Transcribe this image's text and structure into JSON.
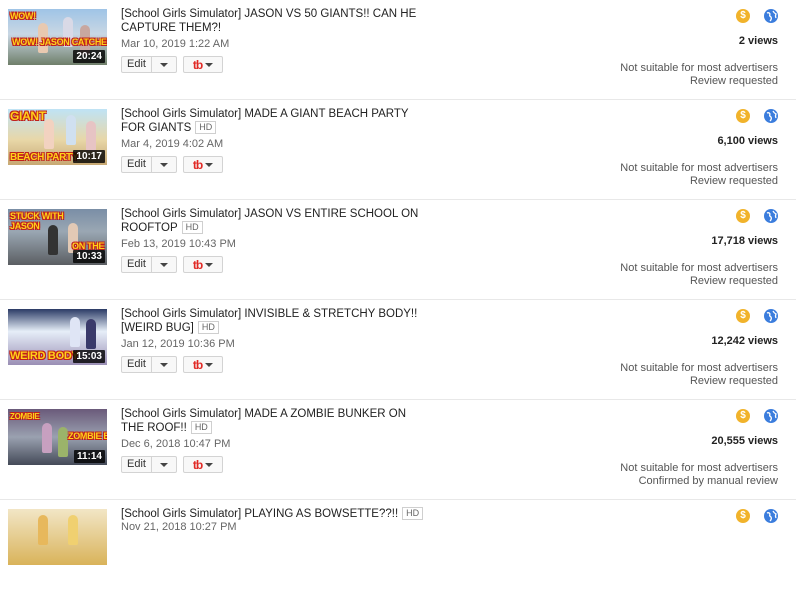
{
  "videos": [
    {
      "title": "[School Girls Simulator] JASON VS 50 GIANTS!! CAN HE CAPTURE THEM?!",
      "hd": "",
      "date": "Mar 10, 2019 1:22 AM",
      "duration": "20:24",
      "thumb_caption": "WOW! JASON CATCHES GIANTS",
      "views": "2 views",
      "ad_status": "Not suitable for most advertisers",
      "review_status": "Review requested"
    },
    {
      "title": "[School Girls Simulator] MADE A GIANT BEACH PARTY FOR GIANTS",
      "hd": "HD",
      "date": "Mar 4, 2019 4:02 AM",
      "duration": "10:17",
      "thumb_caption": "GIANT BEACH PARTY",
      "views": "6,100 views",
      "ad_status": "Not suitable for most advertisers",
      "review_status": "Review requested"
    },
    {
      "title": "[School Girls Simulator] JASON VS ENTIRE SCHOOL ON ROOFTOP",
      "hd": "HD",
      "date": "Feb 13, 2019 10:43 PM",
      "duration": "10:33",
      "thumb_caption": "STUCK WITH JASON ON THE",
      "views": "17,718 views",
      "ad_status": "Not suitable for most advertisers",
      "review_status": "Review requested"
    },
    {
      "title": "[School Girls Simulator] INVISIBLE & STRETCHY BODY!! [WEIRD BUG]",
      "hd": "HD",
      "date": "Jan 12, 2019 10:36 PM",
      "duration": "15:03",
      "thumb_caption": "WEIRD BODY",
      "views": "12,242 views",
      "ad_status": "Not suitable for most advertisers",
      "review_status": "Review requested"
    },
    {
      "title": "[School Girls Simulator] MADE A ZOMBIE BUNKER ON THE ROOF!!",
      "hd": "HD",
      "date": "Dec 6, 2018 10:47 PM",
      "duration": "11:14",
      "thumb_caption": "ZOMBIE BUNKER",
      "views": "20,555 views",
      "ad_status": "Not suitable for most advertisers",
      "review_status": "Confirmed by manual review"
    },
    {
      "title": "[School Girls Simulator] PLAYING AS BOWSETTE??!!",
      "hd": "HD",
      "date": "Nov 21, 2018 10:27 PM",
      "duration": "",
      "thumb_caption": "",
      "views": "",
      "ad_status": "",
      "review_status": ""
    }
  ],
  "labels": {
    "edit": "Edit",
    "tb_logo": "tb",
    "money_symbol": "$"
  },
  "colors": {
    "monetization": "#f1b32b",
    "globe": "#3b7ddd",
    "tubebuddy": "#e12a26"
  },
  "icons": {
    "monetization": "dollar-icon",
    "visibility": "globe-icon"
  }
}
